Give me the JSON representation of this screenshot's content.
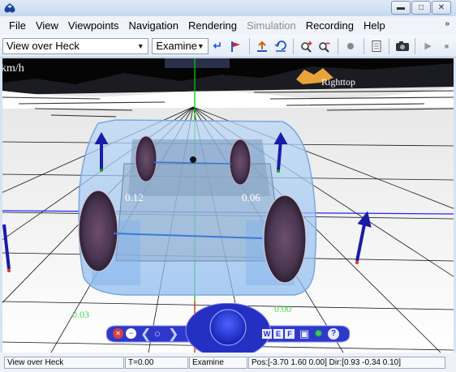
{
  "menubar": {
    "items": [
      "File",
      "View",
      "Viewpoints",
      "Navigation",
      "Rendering",
      "Simulation",
      "Recording",
      "Help"
    ],
    "disabled": [
      "Simulation"
    ]
  },
  "toolbar": {
    "viewpoint_select": "View over Heck",
    "nav_mode_select": "Examine",
    "icons": [
      "return-icon",
      "flag-icon",
      "straighten-icon",
      "undo-move-icon",
      "zoom-in-icon",
      "zoom-out-icon",
      "headlight-icon",
      "document-icon",
      "camera-icon",
      "play-icon",
      "stop-icon"
    ]
  },
  "viewport": {
    "speed_label": "km/h",
    "sign_label": "Righttop",
    "force_labels": [
      "0.12",
      "0.06",
      "0.03",
      "0.00"
    ]
  },
  "nav_panel": {
    "letters": [
      "W",
      "E",
      "F"
    ],
    "help": "?"
  },
  "status": {
    "viewpoint": "View over Heck",
    "time": "T=0.00",
    "mode": "Examine",
    "pos": "Pos:[-3.70 1.60 0.00] Dir:[0.93 -0.34 0.10]"
  },
  "colors": {
    "window_bg": "#d6e3f3",
    "car_body": "#9dc6f4",
    "axis_blue": "#2424ff",
    "axis_green": "#00cc00",
    "axis_red": "#ff2020",
    "label_green": "#4cd84c"
  }
}
